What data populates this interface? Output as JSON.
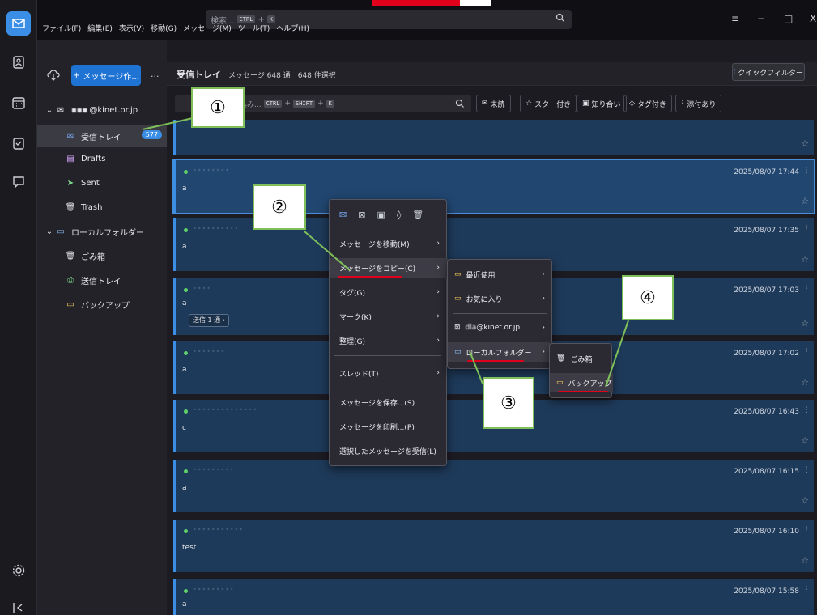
{
  "titlebar": {
    "search_placeholder": "検索...",
    "search_kbd1": "CTRL",
    "search_plus": "+",
    "search_kbd2": "K",
    "win_menu": "≡",
    "win_min": "−",
    "win_max": "□",
    "win_close": "X"
  },
  "menubar": [
    "ファイル(F)",
    "編集(E)",
    "表示(V)",
    "移動(G)",
    "メッセージ(M)",
    "ツール(T)",
    "ヘルプ(H)"
  ],
  "folders": {
    "new_message": "メッセージ作...",
    "more": "···",
    "account": "@kinet.or.jp",
    "inbox": "受信トレイ",
    "inbox_count": "577",
    "drafts": "Drafts",
    "sent": "Sent",
    "trash": "Trash",
    "local": "ローカルフォルダー",
    "local_trash": "ごみ箱",
    "local_outbox": "送信トレイ",
    "local_backup": "バックアップ"
  },
  "thread": {
    "title": "受信トレイ",
    "meta": "メッセージ 648 通　648 件選択",
    "quickfilter": "クイックフィルター",
    "filter_placeholder": "込み...",
    "filter_kbd1": "CTRL",
    "filter_kbd2": "SHIFT",
    "filter_kbd3": "K",
    "chip_unread": "未読",
    "chip_starred": "スター付き",
    "chip_contacts": "知り合い",
    "chip_tags": "タグ付き",
    "chip_attach": "添付あり"
  },
  "messages": [
    {
      "subj": "· · · · ·",
      "prev": "",
      "date": ""
    },
    {
      "subj": "· · · · · · · ·",
      "prev": "a",
      "date": "2025/08/07 17:44"
    },
    {
      "subj": "· · · · · · · · · ·",
      "prev": "a",
      "date": "2025/08/07 17:35"
    },
    {
      "subj": "· · · ·",
      "prev": "a",
      "date": "2025/08/07 17:03",
      "reply": "送信 1 通 ›"
    },
    {
      "subj": "· · · · · · ·",
      "prev": "a",
      "date": "2025/08/07 17:02"
    },
    {
      "subj": "· · · · · · · · · · · · · ·",
      "prev": "c",
      "date": "2025/08/07 16:43"
    },
    {
      "subj": "· · · · · · · · ·",
      "prev": "a",
      "date": "2025/08/07 16:15"
    },
    {
      "subj": "· · · · · · · · · · ·",
      "prev": "test",
      "date": "2025/08/07 16:10"
    },
    {
      "subj": "· · · · · · · · ·",
      "prev": "a",
      "date": "2025/08/07 15:58"
    }
  ],
  "context_menu": {
    "move": "メッセージを移動(M)",
    "copy": "メッセージをコピー(C)",
    "tag": "タグ(G)",
    "mark": "マーク(K)",
    "organize": "整理(G)",
    "thread": "スレッド(T)",
    "save": "メッセージを保存...(S)",
    "print": "メッセージを印刷...(P)",
    "receive": "選択したメッセージを受信(L)"
  },
  "submenu1": {
    "recent": "最近使用",
    "favorites": "お気に入り",
    "account": "@kinet.or.jp",
    "local": "ローカルフォルダー"
  },
  "submenu2": {
    "trash": "ごみ箱",
    "backup": "バックアップ"
  },
  "annotations": [
    "①",
    "②",
    "③",
    "④"
  ],
  "colors": {
    "accent": "#3b8ee6",
    "annotation_border": "#7fbf5a",
    "underline": "#e0001b"
  }
}
